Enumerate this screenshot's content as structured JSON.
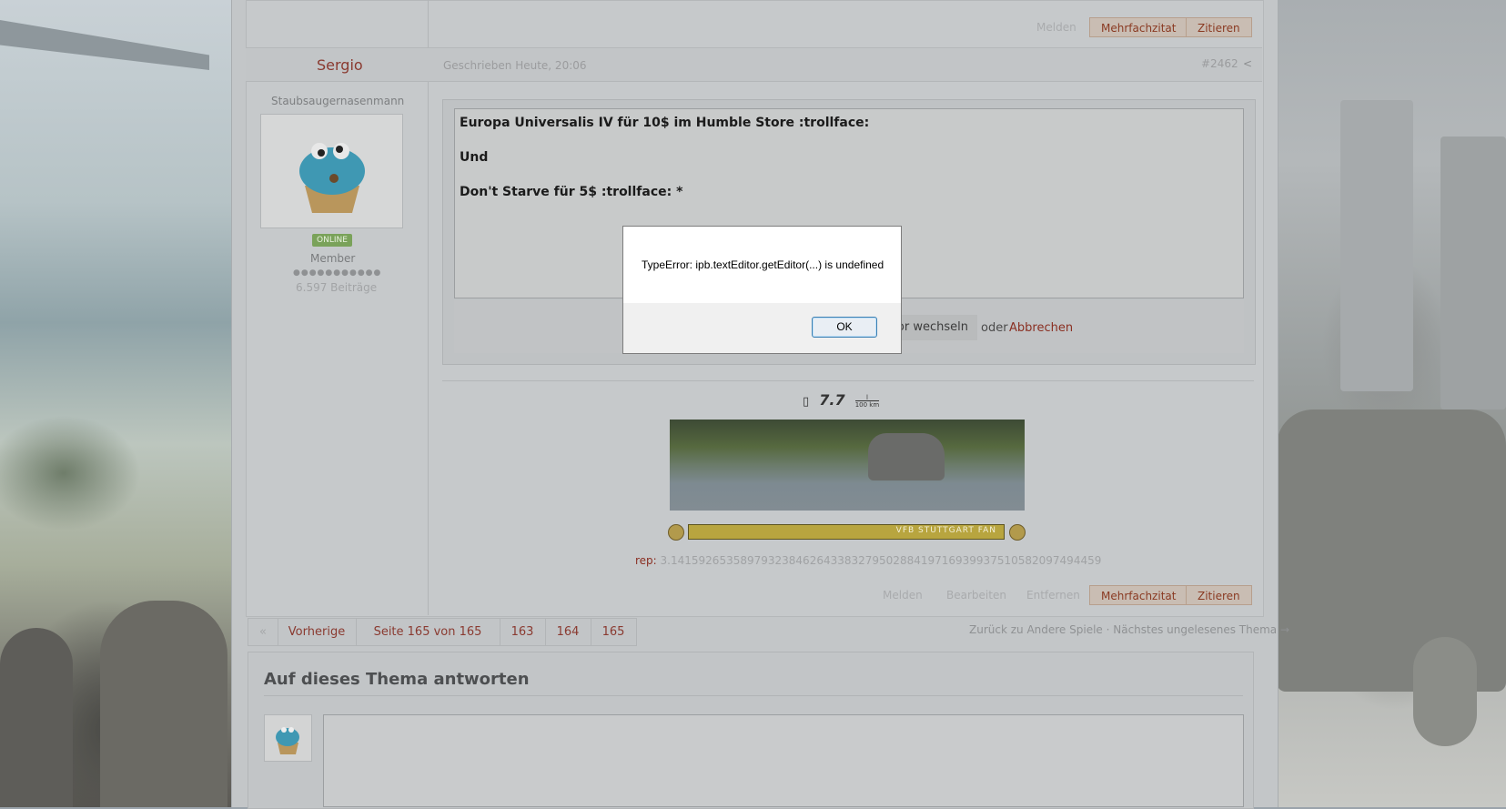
{
  "post_actions_top": {
    "report": "Melden",
    "multiquote": "Mehrfachzitat",
    "quote": "Zitieren"
  },
  "post": {
    "author": "Sergio",
    "written": "Geschrieben Heute, 20:06",
    "number": "#2462",
    "user_title": "Staubsaugernasenmann",
    "online_badge": "ONLINE",
    "rank": "Member",
    "pips": "●●●●●●●●●●●",
    "post_count": "6.597 Beiträge"
  },
  "editor": {
    "lines": [
      "Europa Universalis IV für 10$ im Humble Store :trollface:",
      "Und",
      "Don't Starve für 5$ :trollface: *"
    ],
    "switch_label": "or wechseln",
    "or_text": "oder",
    "cancel": "Abbrechen"
  },
  "signature": {
    "fuel_value": "7.7",
    "fuel_unit_top": "l",
    "fuel_unit_bottom": "100 km",
    "banner_text": "VFB STUTTGART FAN",
    "rep_label": "rep:",
    "rep_value": "3.14159265358979323846264338327950288419716939937510582097494459"
  },
  "post_actions_bottom": {
    "report": "Melden",
    "edit": "Bearbeiten",
    "delete": "Entfernen",
    "multiquote": "Mehrfachzitat",
    "quote": "Zitieren"
  },
  "pagination": {
    "first": "«",
    "prev": "Vorherige",
    "page_info": "Seite 165 von 165",
    "pages": [
      "163",
      "164",
      "165"
    ],
    "back_link": "Zurück zu Andere Spiele · Nächstes ungelesenes Thema →"
  },
  "reply": {
    "title": "Auf dieses Thema antworten"
  },
  "dialog": {
    "message": "TypeError: ipb.textEditor.getEditor(...) is undefined",
    "ok": "OK"
  }
}
